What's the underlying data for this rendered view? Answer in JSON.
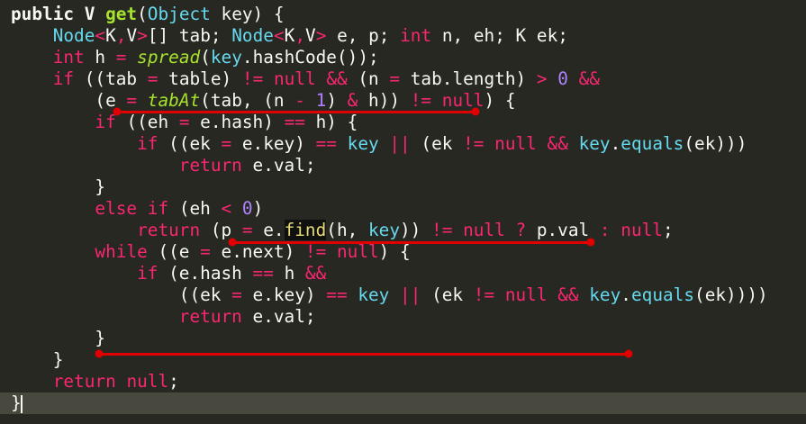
{
  "editor": {
    "theme": {
      "background": "#272822",
      "current_line": "#49483e",
      "annotation": "#e00000"
    },
    "colors": {
      "default": "#f8f8f2",
      "keyword": "#f92672",
      "type": "#66d9ef",
      "number": "#ae81ff",
      "function": "#a6e22e",
      "highlight_fg": "#e6db74"
    },
    "lines": [
      [
        [
          "public V ",
          "default",
          "b"
        ],
        [
          "get",
          "function",
          "b"
        ],
        [
          "(",
          "default"
        ],
        [
          "Object",
          "type"
        ],
        [
          " key) {",
          "default"
        ]
      ],
      [
        [
          "    ",
          "default"
        ],
        [
          "Node",
          "type"
        ],
        [
          "<",
          "keyword"
        ],
        [
          "K",
          "default"
        ],
        [
          ",",
          "keyword"
        ],
        [
          "V",
          "default"
        ],
        [
          ">",
          "keyword"
        ],
        [
          "[] tab; ",
          "default"
        ],
        [
          "Node",
          "type"
        ],
        [
          "<",
          "keyword"
        ],
        [
          "K",
          "default"
        ],
        [
          ",",
          "keyword"
        ],
        [
          "V",
          "default"
        ],
        [
          ">",
          "keyword"
        ],
        [
          " e, p; ",
          "default"
        ],
        [
          "int",
          "keyword"
        ],
        [
          " n, eh; K ek;",
          "default"
        ]
      ],
      [
        [
          "    ",
          "default"
        ],
        [
          "int",
          "keyword"
        ],
        [
          " h ",
          "default"
        ],
        [
          "=",
          "keyword"
        ],
        [
          " ",
          "default"
        ],
        [
          "spread",
          "function",
          "i"
        ],
        [
          "(",
          "default"
        ],
        [
          "key",
          "type"
        ],
        [
          ".hashCode());",
          "default"
        ]
      ],
      [
        [
          "    ",
          "default"
        ],
        [
          "if",
          "keyword"
        ],
        [
          " ((tab ",
          "default"
        ],
        [
          "=",
          "keyword"
        ],
        [
          " table) ",
          "default"
        ],
        [
          "!=",
          "keyword"
        ],
        [
          " ",
          "default"
        ],
        [
          "null",
          "keyword"
        ],
        [
          " ",
          "default"
        ],
        [
          "&&",
          "keyword"
        ],
        [
          " (n ",
          "default"
        ],
        [
          "=",
          "keyword"
        ],
        [
          " tab.length) ",
          "default"
        ],
        [
          ">",
          "keyword"
        ],
        [
          " ",
          "default"
        ],
        [
          "0",
          "number"
        ],
        [
          " ",
          "default"
        ],
        [
          "&&",
          "keyword"
        ]
      ],
      [
        [
          "        (e ",
          "default"
        ],
        [
          "=",
          "keyword"
        ],
        [
          " ",
          "default"
        ],
        [
          "tabAt",
          "function",
          "i"
        ],
        [
          "(tab, (n ",
          "default"
        ],
        [
          "-",
          "keyword"
        ],
        [
          " ",
          "default"
        ],
        [
          "1",
          "number"
        ],
        [
          ") ",
          "default"
        ],
        [
          "&",
          "keyword"
        ],
        [
          " h)) ",
          "default"
        ],
        [
          "!=",
          "keyword"
        ],
        [
          " ",
          "default"
        ],
        [
          "null",
          "keyword"
        ],
        [
          ") {",
          "default"
        ]
      ],
      [
        [
          "        ",
          "default"
        ],
        [
          "if",
          "keyword"
        ],
        [
          " ((eh ",
          "default"
        ],
        [
          "=",
          "keyword"
        ],
        [
          " e.hash) ",
          "default"
        ],
        [
          "==",
          "keyword"
        ],
        [
          " h) {",
          "default"
        ]
      ],
      [
        [
          "            ",
          "default"
        ],
        [
          "if",
          "keyword"
        ],
        [
          " ((ek ",
          "default"
        ],
        [
          "=",
          "keyword"
        ],
        [
          " e.key) ",
          "default"
        ],
        [
          "==",
          "keyword"
        ],
        [
          " ",
          "default"
        ],
        [
          "key",
          "type"
        ],
        [
          " ",
          "default"
        ],
        [
          "||",
          "keyword"
        ],
        [
          " (ek ",
          "default"
        ],
        [
          "!=",
          "keyword"
        ],
        [
          " ",
          "default"
        ],
        [
          "null",
          "keyword"
        ],
        [
          " ",
          "default"
        ],
        [
          "&&",
          "keyword"
        ],
        [
          " ",
          "default"
        ],
        [
          "key",
          "type"
        ],
        [
          ".",
          "default"
        ],
        [
          "equals",
          "type"
        ],
        [
          "(ek)))",
          "default"
        ]
      ],
      [
        [
          "                ",
          "default"
        ],
        [
          "return",
          "keyword"
        ],
        [
          " e.val;",
          "default"
        ]
      ],
      [
        [
          "        }",
          "default"
        ]
      ],
      [
        [
          "        ",
          "default"
        ],
        [
          "else",
          "keyword"
        ],
        [
          " ",
          "default"
        ],
        [
          "if",
          "keyword"
        ],
        [
          " (eh ",
          "default"
        ],
        [
          "<",
          "keyword"
        ],
        [
          " ",
          "default"
        ],
        [
          "0",
          "number"
        ],
        [
          ")",
          "default"
        ]
      ],
      [
        [
          "            ",
          "default"
        ],
        [
          "return",
          "keyword"
        ],
        [
          " (p ",
          "default"
        ],
        [
          "=",
          "keyword"
        ],
        [
          " e.",
          "default"
        ],
        [
          "find",
          "highlight"
        ],
        [
          "(h, ",
          "default"
        ],
        [
          "key",
          "type"
        ],
        [
          ")) ",
          "default"
        ],
        [
          "!=",
          "keyword"
        ],
        [
          " ",
          "default"
        ],
        [
          "null",
          "keyword"
        ],
        [
          " ",
          "default"
        ],
        [
          "?",
          "keyword"
        ],
        [
          " p.val ",
          "default"
        ],
        [
          ":",
          "keyword"
        ],
        [
          " ",
          "default"
        ],
        [
          "null",
          "keyword"
        ],
        [
          ";",
          "default"
        ]
      ],
      [
        [
          "        ",
          "default"
        ],
        [
          "while",
          "keyword"
        ],
        [
          " ((e ",
          "default"
        ],
        [
          "=",
          "keyword"
        ],
        [
          " e.next) ",
          "default"
        ],
        [
          "!=",
          "keyword"
        ],
        [
          " ",
          "default"
        ],
        [
          "null",
          "keyword"
        ],
        [
          ") {",
          "default"
        ]
      ],
      [
        [
          "            ",
          "default"
        ],
        [
          "if",
          "keyword"
        ],
        [
          " (e.hash ",
          "default"
        ],
        [
          "==",
          "keyword"
        ],
        [
          " h ",
          "default"
        ],
        [
          "&&",
          "keyword"
        ]
      ],
      [
        [
          "                ((ek ",
          "default"
        ],
        [
          "=",
          "keyword"
        ],
        [
          " e.key) ",
          "default"
        ],
        [
          "==",
          "keyword"
        ],
        [
          " ",
          "default"
        ],
        [
          "key",
          "type"
        ],
        [
          " ",
          "default"
        ],
        [
          "||",
          "keyword"
        ],
        [
          " (ek ",
          "default"
        ],
        [
          "!=",
          "keyword"
        ],
        [
          " ",
          "default"
        ],
        [
          "null",
          "keyword"
        ],
        [
          " ",
          "default"
        ],
        [
          "&&",
          "keyword"
        ],
        [
          " ",
          "default"
        ],
        [
          "key",
          "type"
        ],
        [
          ".",
          "default"
        ],
        [
          "equals",
          "type"
        ],
        [
          "(ek))))",
          "default"
        ]
      ],
      [
        [
          "                ",
          "default"
        ],
        [
          "return",
          "keyword"
        ],
        [
          " e.val;",
          "default"
        ]
      ],
      [
        [
          "        }",
          "default"
        ]
      ],
      [
        [
          "    }",
          "default"
        ]
      ],
      [
        [
          "    ",
          "default"
        ],
        [
          "return",
          "keyword"
        ],
        [
          " ",
          "default"
        ],
        [
          "null",
          "keyword"
        ],
        [
          ";",
          "default"
        ]
      ],
      [
        [
          "}",
          "default"
        ]
      ]
    ]
  }
}
